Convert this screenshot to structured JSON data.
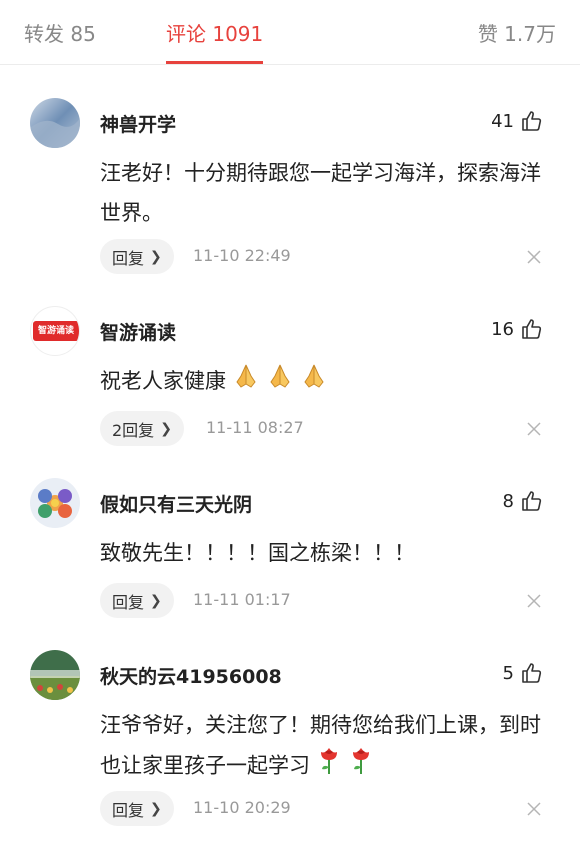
{
  "tabs": {
    "repost": "转发 85",
    "comments": "评论 1091",
    "likes": "赞 1.7万"
  },
  "comments": [
    {
      "name": "神兽开学",
      "likes": "41",
      "text": "汪老好！十分期待跟您一起学习海洋，探索海洋世界。",
      "reply": "回复",
      "time": "11-10 22:49"
    },
    {
      "name": "智游诵读",
      "avatar_text": "智游诵读",
      "likes": "16",
      "text": "祝老人家健康",
      "emoji": [
        "folded-hands",
        "folded-hands",
        "folded-hands"
      ],
      "reply": "2回复",
      "time": "11-11 08:27"
    },
    {
      "name": "假如只有三天光阴",
      "likes": "8",
      "text": "致敬先生！！！！国之栋梁！！！",
      "reply": "回复",
      "time": "11-11 01:17"
    },
    {
      "name": "秋天的云41956008",
      "likes": "5",
      "text": "汪爷爷好，关注您了！期待您给我们上课，到时也让家里孩子一起学习",
      "emoji": [
        "rose",
        "rose"
      ],
      "reply": "回复",
      "time": "11-10 20:29"
    }
  ],
  "colors": {
    "accent": "#e7423d",
    "muted": "#999999"
  }
}
